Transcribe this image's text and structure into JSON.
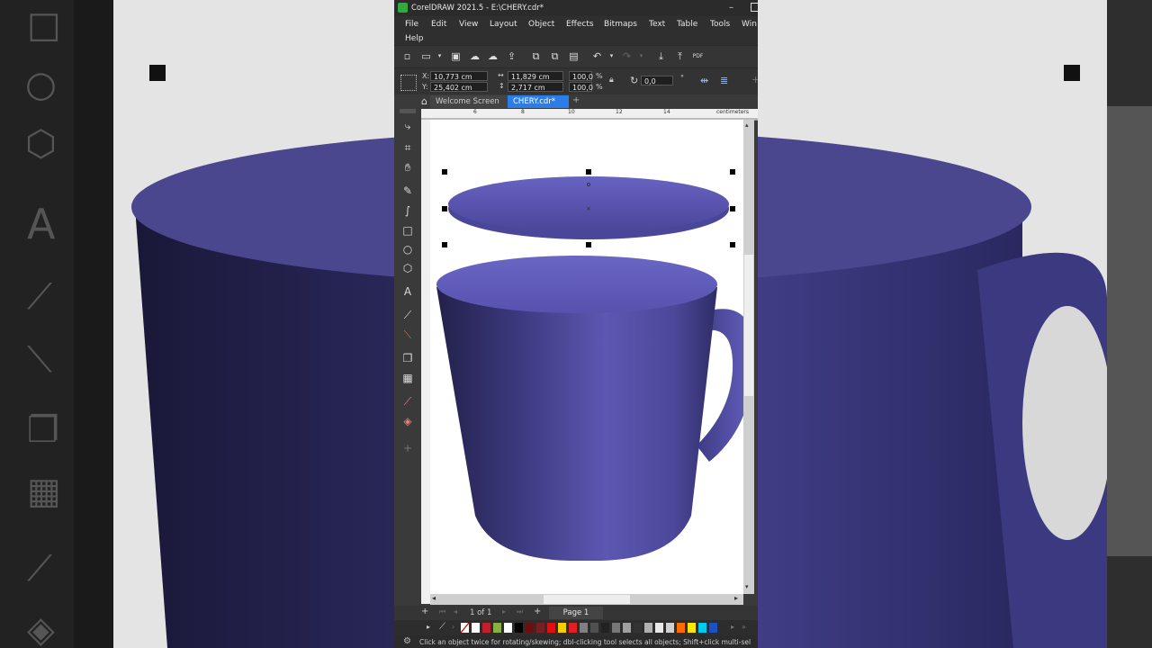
{
  "window": {
    "title": "CorelDRAW 2021.5 - E:\\CHERY.cdr*"
  },
  "menu": [
    {
      "label": "File"
    },
    {
      "label": "Edit"
    },
    {
      "label": "View"
    },
    {
      "label": "Layout"
    },
    {
      "label": "Object"
    },
    {
      "label": "Effects"
    },
    {
      "label": "Bitmaps"
    },
    {
      "label": "Text"
    },
    {
      "label": "Table"
    },
    {
      "label": "Tools"
    },
    {
      "label": "Win"
    },
    {
      "label": "Help"
    }
  ],
  "property_bar": {
    "x_label": "X:",
    "x_value": "10,773 cm",
    "y_label": "Y:",
    "y_value": "25,402 cm",
    "width_value": "11,829 cm",
    "height_value": "2,717 cm",
    "scale_x": "100,0",
    "scale_y": "100,0",
    "percent": "%",
    "rotation": "0,0",
    "degree": "°"
  },
  "tabs": [
    {
      "label": "Welcome Screen"
    },
    {
      "label": "CHERY.cdr*"
    }
  ],
  "ruler": {
    "h_ticks": [
      "6",
      "8",
      "10",
      "12",
      "14"
    ],
    "unit": "centimeters"
  },
  "page_nav": {
    "count": "1 of 1",
    "page_tab": "Page 1"
  },
  "status": {
    "text": "Click an object twice for rotating/skewing; dbl-clicking tool selects all objects; Shift+click multi-sel"
  },
  "colors": {
    "accent": "#2b7de9",
    "mug": "#5b57b0",
    "mug_dark": "#2f2c66",
    "mug_light": "#6a66c4"
  },
  "palette": [
    "#ffffff",
    "#c0202c",
    "#88b040",
    "#ffffff",
    "#000000",
    "#6a1010",
    "#7a1f1f",
    "#e01010",
    "#f4d000",
    "#e02020",
    "#808080",
    "#505050",
    "#222222",
    "#777777",
    "#a0a0a0",
    "#333333",
    "#b0b0b0",
    "#e8e8e8",
    "#d0d0d0",
    "#ff6a00",
    "#ffe600",
    "#00c8f0",
    "#2050c0"
  ]
}
